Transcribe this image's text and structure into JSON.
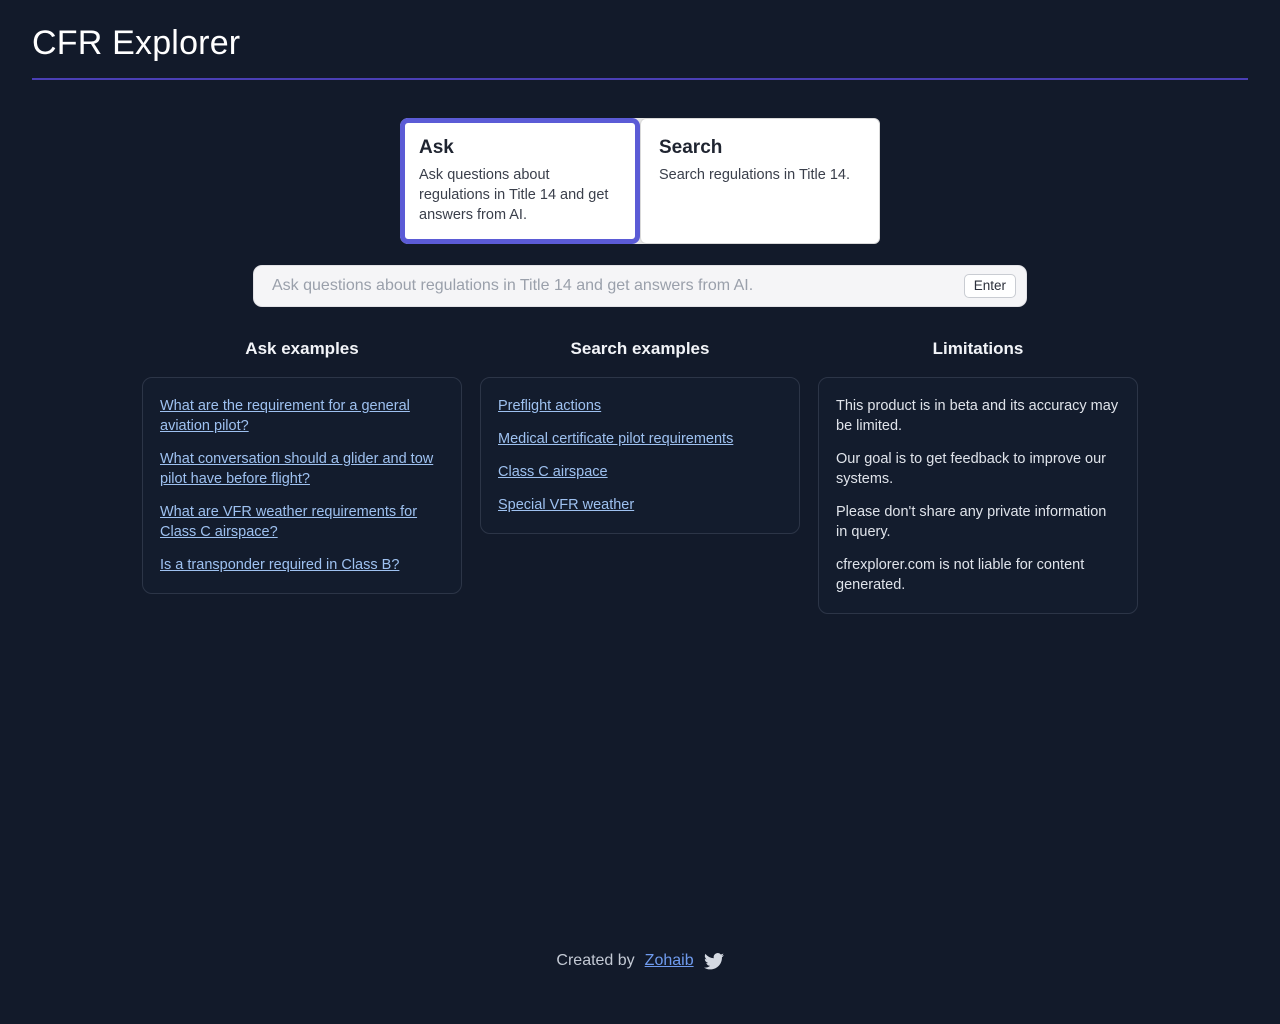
{
  "header": {
    "title": "CFR Explorer",
    "divider_color": "#4a3fb5"
  },
  "tabs": {
    "selected": "Ask",
    "items": [
      {
        "label": "Ask",
        "description": "Ask questions about regulations in Title 14 and get answers from AI.",
        "selected": true
      },
      {
        "label": "Search",
        "description": "Search regulations in Title 14.",
        "selected": false
      }
    ],
    "selected_border_color": "#5b5bd6"
  },
  "search": {
    "value": "",
    "placeholder": "Ask questions about regulations in Title 14 and get answers from AI.",
    "enter_label": "Enter"
  },
  "columns": {
    "ask_examples": {
      "title": "Ask examples",
      "items": [
        "What are the requirement for a general aviation pilot?",
        "What conversation should a glider and tow pilot have before flight?",
        "What are VFR weather requirements for Class C airspace?",
        "Is a transponder required in Class B?"
      ]
    },
    "search_examples": {
      "title": "Search examples",
      "items": [
        "Preflight actions",
        "Medical certificate pilot requirements",
        "Class C airspace",
        "Special VFR weather"
      ]
    },
    "limitations": {
      "title": "Limitations",
      "items": [
        "This product is in beta and its accuracy may be limited.",
        "Our goal is to get feedback to improve our systems.",
        "Please don't share any private information in query.",
        "cfrexplorer.com is not liable for content generated."
      ]
    }
  },
  "footer": {
    "created_by": "Created by",
    "author": "Zohaib",
    "twitter_icon": "twitter-bird-icon"
  },
  "colors": {
    "background": "#121a2a",
    "link": "#9ec1f0",
    "accent": "#5b5bd6"
  }
}
